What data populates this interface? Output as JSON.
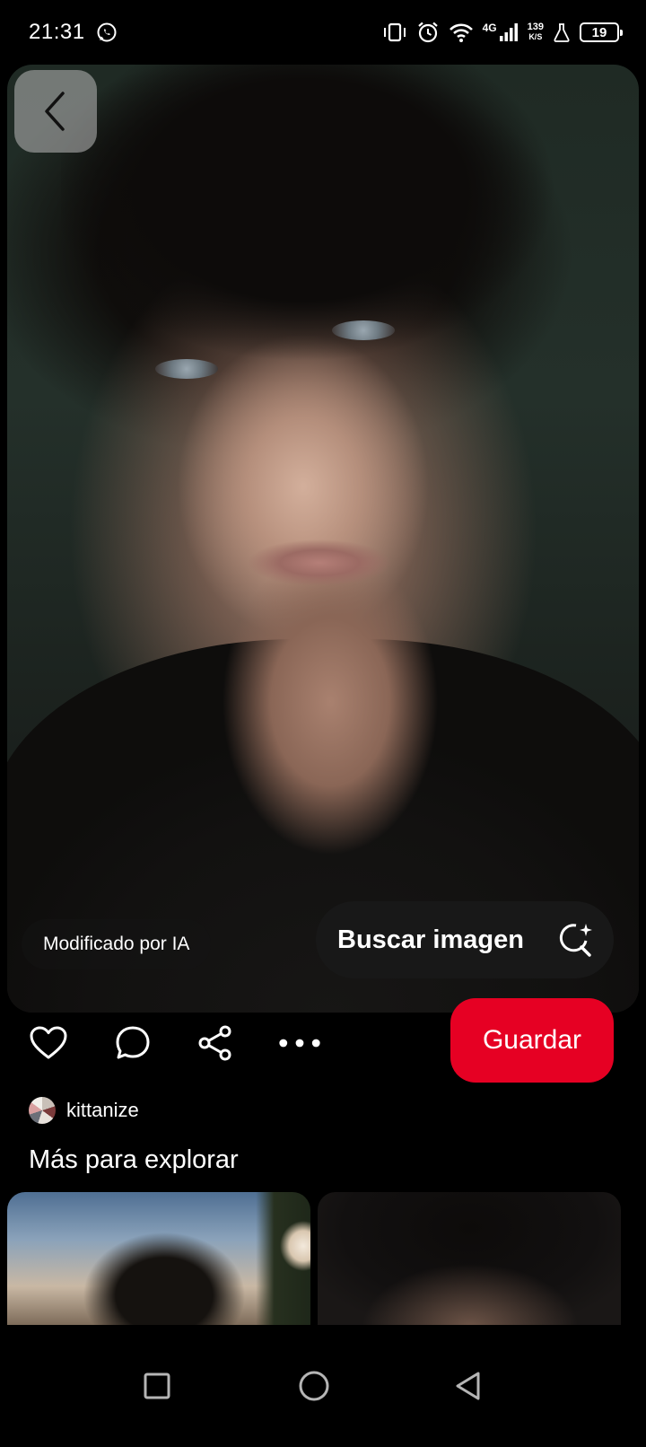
{
  "status_bar": {
    "time": "21:31",
    "network_type": "4G",
    "speed_value": "139",
    "speed_unit": "K/S",
    "battery_level": "19"
  },
  "pin": {
    "ai_badge": "Modificado por IA",
    "visual_search_label": "Buscar imagen"
  },
  "actions": {
    "save_label": "Guardar"
  },
  "creator": {
    "name": "kittanize"
  },
  "explore": {
    "title": "Más para explorar"
  },
  "colors": {
    "save_button": "#e60023",
    "background": "#000000"
  }
}
